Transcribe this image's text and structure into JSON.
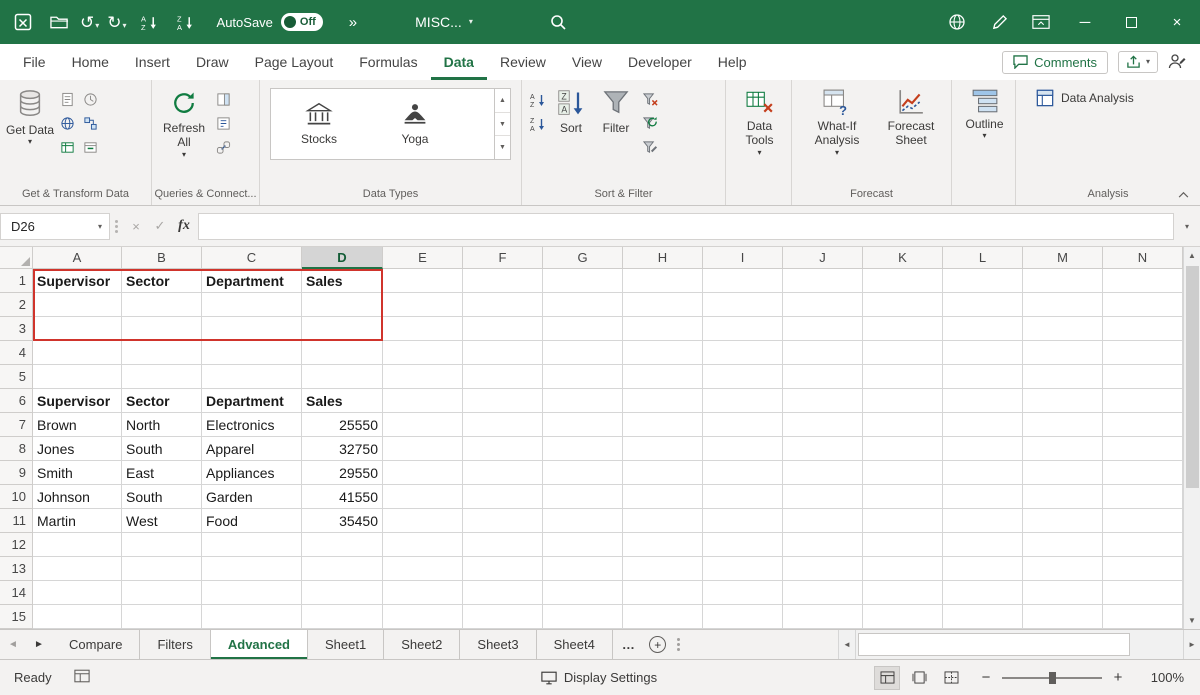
{
  "colors": {
    "excel_green": "#217346",
    "ribbon_bg": "#f3f2f1",
    "highlight_red": "#d0342c"
  },
  "icons": {
    "undo": "↺",
    "redo": "↻",
    "more_commands": "»",
    "dropdown": "▾",
    "cancel": "×",
    "enter": "✓",
    "function_symbol": "fx",
    "scroll_up": "▲",
    "scroll_down": "▼",
    "scroll_left": "◄",
    "scroll_right": "►",
    "sheet_prev": "◄",
    "sheet_next": "►",
    "more_sheets": "…",
    "add_sheet": "+",
    "zoom_out": "−",
    "zoom_in": "+",
    "minimize": "─",
    "close": "×"
  },
  "titlebar": {
    "autosave_label": "AutoSave",
    "autosave_state": "Off",
    "filename": "MISC..."
  },
  "tabs": {
    "items": [
      "File",
      "Home",
      "Insert",
      "Draw",
      "Page Layout",
      "Formulas",
      "Data",
      "Review",
      "View",
      "Developer",
      "Help"
    ],
    "active": "Data",
    "comments": "Comments"
  },
  "ribbon": {
    "groups": [
      {
        "label": "Get & Transform Data",
        "buttons": [
          {
            "label": "Get Data"
          }
        ]
      },
      {
        "label": "Queries & Connect...",
        "buttons": [
          {
            "label": "Refresh All"
          }
        ]
      },
      {
        "label": "Data Types",
        "buttons": [
          {
            "label": "Stocks"
          },
          {
            "label": "Yoga"
          }
        ]
      },
      {
        "label": "Sort & Filter",
        "buttons": [
          {
            "label": "Sort"
          },
          {
            "label": "Filter"
          }
        ]
      },
      {
        "buttons": [
          {
            "label": "Data Tools"
          }
        ]
      },
      {
        "label": "Forecast",
        "buttons": [
          {
            "label": "What-If Analysis"
          },
          {
            "label": "Forecast Sheet"
          }
        ]
      },
      {
        "buttons": [
          {
            "label": "Outline"
          }
        ]
      },
      {
        "label": "Analysis",
        "buttons": [
          {
            "label": "Data Analysis"
          }
        ]
      }
    ]
  },
  "formula_bar": {
    "name_box": "D26"
  },
  "sheet": {
    "name_box": "D26",
    "columns": [
      "A",
      "B",
      "C",
      "D",
      "E",
      "F",
      "G",
      "H",
      "I",
      "J",
      "K",
      "L",
      "M",
      "N"
    ],
    "visible_rows": 15,
    "selected_column": "D",
    "bold_rows": [
      1,
      6
    ],
    "cells": {
      "1": {
        "A": "Supervisor",
        "B": "Sector",
        "C": "Department",
        "D": "Sales"
      },
      "6": {
        "A": "Supervisor",
        "B": "Sector",
        "C": "Department",
        "D": "Sales"
      },
      "7": {
        "A": "Brown",
        "B": "North",
        "C": "Electronics",
        "D": "25550"
      },
      "8": {
        "A": "Jones",
        "B": "South",
        "C": "Apparel",
        "D": "32750"
      },
      "9": {
        "A": "Smith",
        "B": "East",
        "C": "Appliances",
        "D": "29550"
      },
      "10": {
        "A": "Johnson",
        "B": "South",
        "C": "Garden",
        "D": "41550"
      },
      "11": {
        "A": "Martin",
        "B": "West",
        "C": "Food",
        "D": "35450"
      }
    },
    "red_box": {
      "from": "A1",
      "to": "D3"
    }
  },
  "sheet_tabs": {
    "items": [
      "Compare",
      "Filters",
      "Advanced",
      "Sheet1",
      "Sheet2",
      "Sheet3",
      "Sheet4"
    ],
    "active": "Advanced",
    "overflow": "…"
  },
  "status_bar": {
    "mode": "Ready",
    "display_settings": "Display Settings",
    "zoom": "100%"
  }
}
